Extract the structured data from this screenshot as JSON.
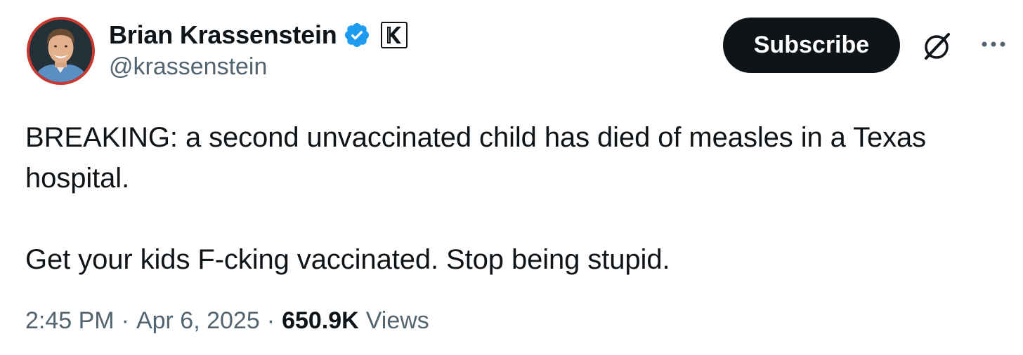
{
  "author": {
    "display_name": "Brian Krassenstein",
    "handle": "@krassenstein",
    "verified": true,
    "affiliate_badge_letter": "K"
  },
  "actions": {
    "subscribe_label": "Subscribe",
    "grok_icon": "grok-icon",
    "more_icon": "more-horizontal-icon"
  },
  "tweet": {
    "paragraph_1": "BREAKING: a second unvaccinated child has died of measles in a Texas hospital.",
    "paragraph_2": "Get your kids F-cking vaccinated. Stop being stupid."
  },
  "meta": {
    "time": "2:45 PM",
    "separator": "·",
    "date": "Apr 6, 2025",
    "views_count": "650.9K",
    "views_label": "Views"
  },
  "colors": {
    "text_primary": "#0f1419",
    "text_secondary": "#536471",
    "verified_blue": "#1d9bf0",
    "avatar_ring": "#c8382f",
    "button_bg": "#0f1419"
  }
}
